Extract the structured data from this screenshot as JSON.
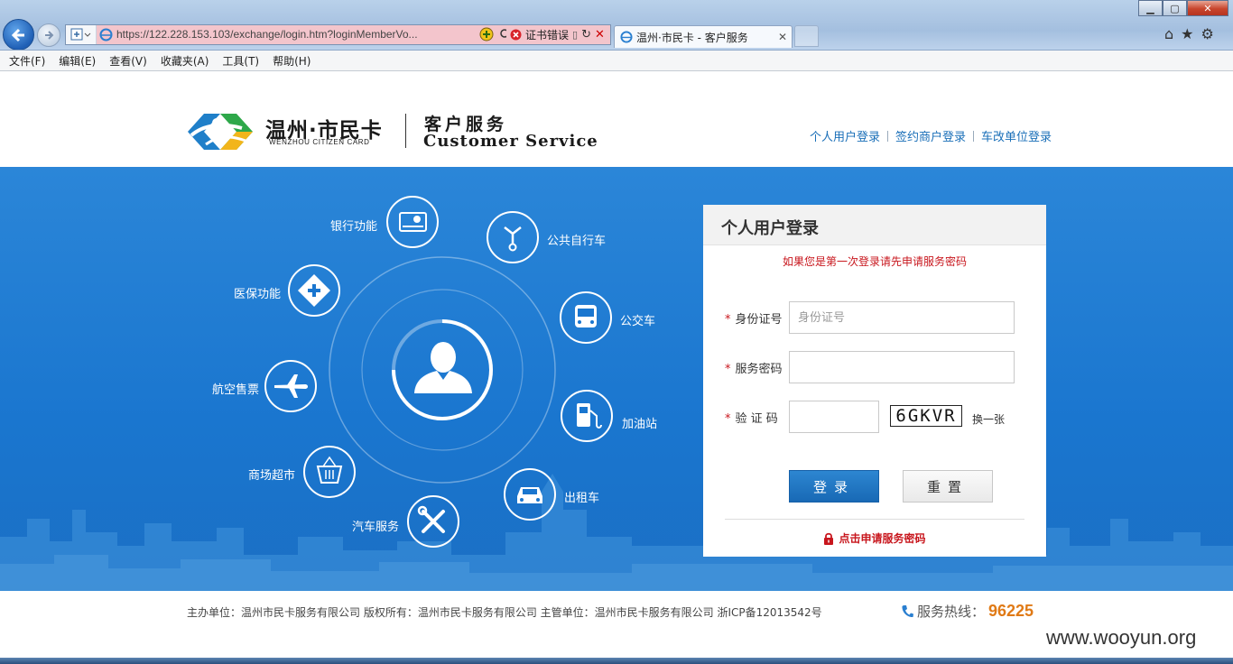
{
  "browser": {
    "address_url": "https://122.228.153.103/exchange/login.htm?loginMemberVo...",
    "cert_error": "证书错误",
    "tab_title": "温州·市民卡 - 客户服务"
  },
  "menu": [
    "文件(F)",
    "编辑(E)",
    "查看(V)",
    "收藏夹(A)",
    "工具(T)",
    "帮助(H)"
  ],
  "header": {
    "brand_cn": "温州·市民卡",
    "brand_en": "WENZHOU CITIZEN CARD",
    "service_cn": "客户服务",
    "service_en": "Customer Service",
    "links": [
      "个人用户登录",
      "签约商户登录",
      "车改单位登录"
    ]
  },
  "features": {
    "bank": "银行功能",
    "bike": "公共自行车",
    "medical": "医保功能",
    "bus": "公交车",
    "flight": "航空售票",
    "gas": "加油站",
    "mall": "商场超市",
    "taxi": "出租车",
    "car": "汽车服务"
  },
  "login": {
    "title": "个人用户登录",
    "note": "如果您是第一次登录请先申请服务密码",
    "id_label": "身份证号",
    "id_placeholder": "身份证号",
    "password_label": "服务密码",
    "captcha_label": "验 证 码",
    "captcha_code": "6GKVR",
    "captcha_refresh": "换一张",
    "login_button": "登录",
    "reset_button": "重置",
    "apply_link": "点击申请服务密码"
  },
  "footer": {
    "info": "主办单位：温州市民卡服务有限公司 版权所有：温州市民卡服务有限公司 主管单位：温州市民卡服务有限公司 浙ICP备12013542号",
    "hotline_label": "服务热线：",
    "hotline_number": "96225"
  },
  "watermark": "www.wooyun.org"
}
